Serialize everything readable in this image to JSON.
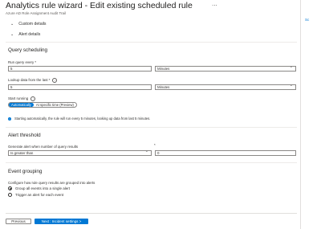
{
  "header": {
    "title": "Analytics rule wizard - Edit existing scheduled rule",
    "ellipsis": "...",
    "subtitle": "Azure AD Role Assignment Audit Trail",
    "right_stub": "Sc"
  },
  "collapsibles": [
    {
      "label": "Custom details"
    },
    {
      "label": "Alert details"
    }
  ],
  "query_scheduling": {
    "heading": "Query scheduling",
    "run_every_label": "Run query every *",
    "run_every_value": "5",
    "run_every_unit": "Minutes",
    "lookup_label": "Lookup data from the last *",
    "lookup_value": "5",
    "lookup_unit": "Minutes",
    "start_label": "Start running",
    "start_options": [
      "Automatically",
      "At specific time (Preview)"
    ],
    "start_selected": "Automatically",
    "info_text": "Starting automatically, the rule will run every 5 minutes, looking up data from last 5 minutes."
  },
  "alert_threshold": {
    "heading": "Alert threshold",
    "label": "Generate alert when number of query results",
    "operator": "Is greater than",
    "required_mark": "*",
    "value": "0"
  },
  "event_grouping": {
    "heading": "Event grouping",
    "description": "Configure how rule query results are grouped into alerts",
    "options": [
      "Group all events into a single alert",
      "Trigger an alert for each event"
    ],
    "selected_index": 0
  },
  "footer": {
    "previous_label": "Previous",
    "next_label": "Next : Incident settings >"
  }
}
